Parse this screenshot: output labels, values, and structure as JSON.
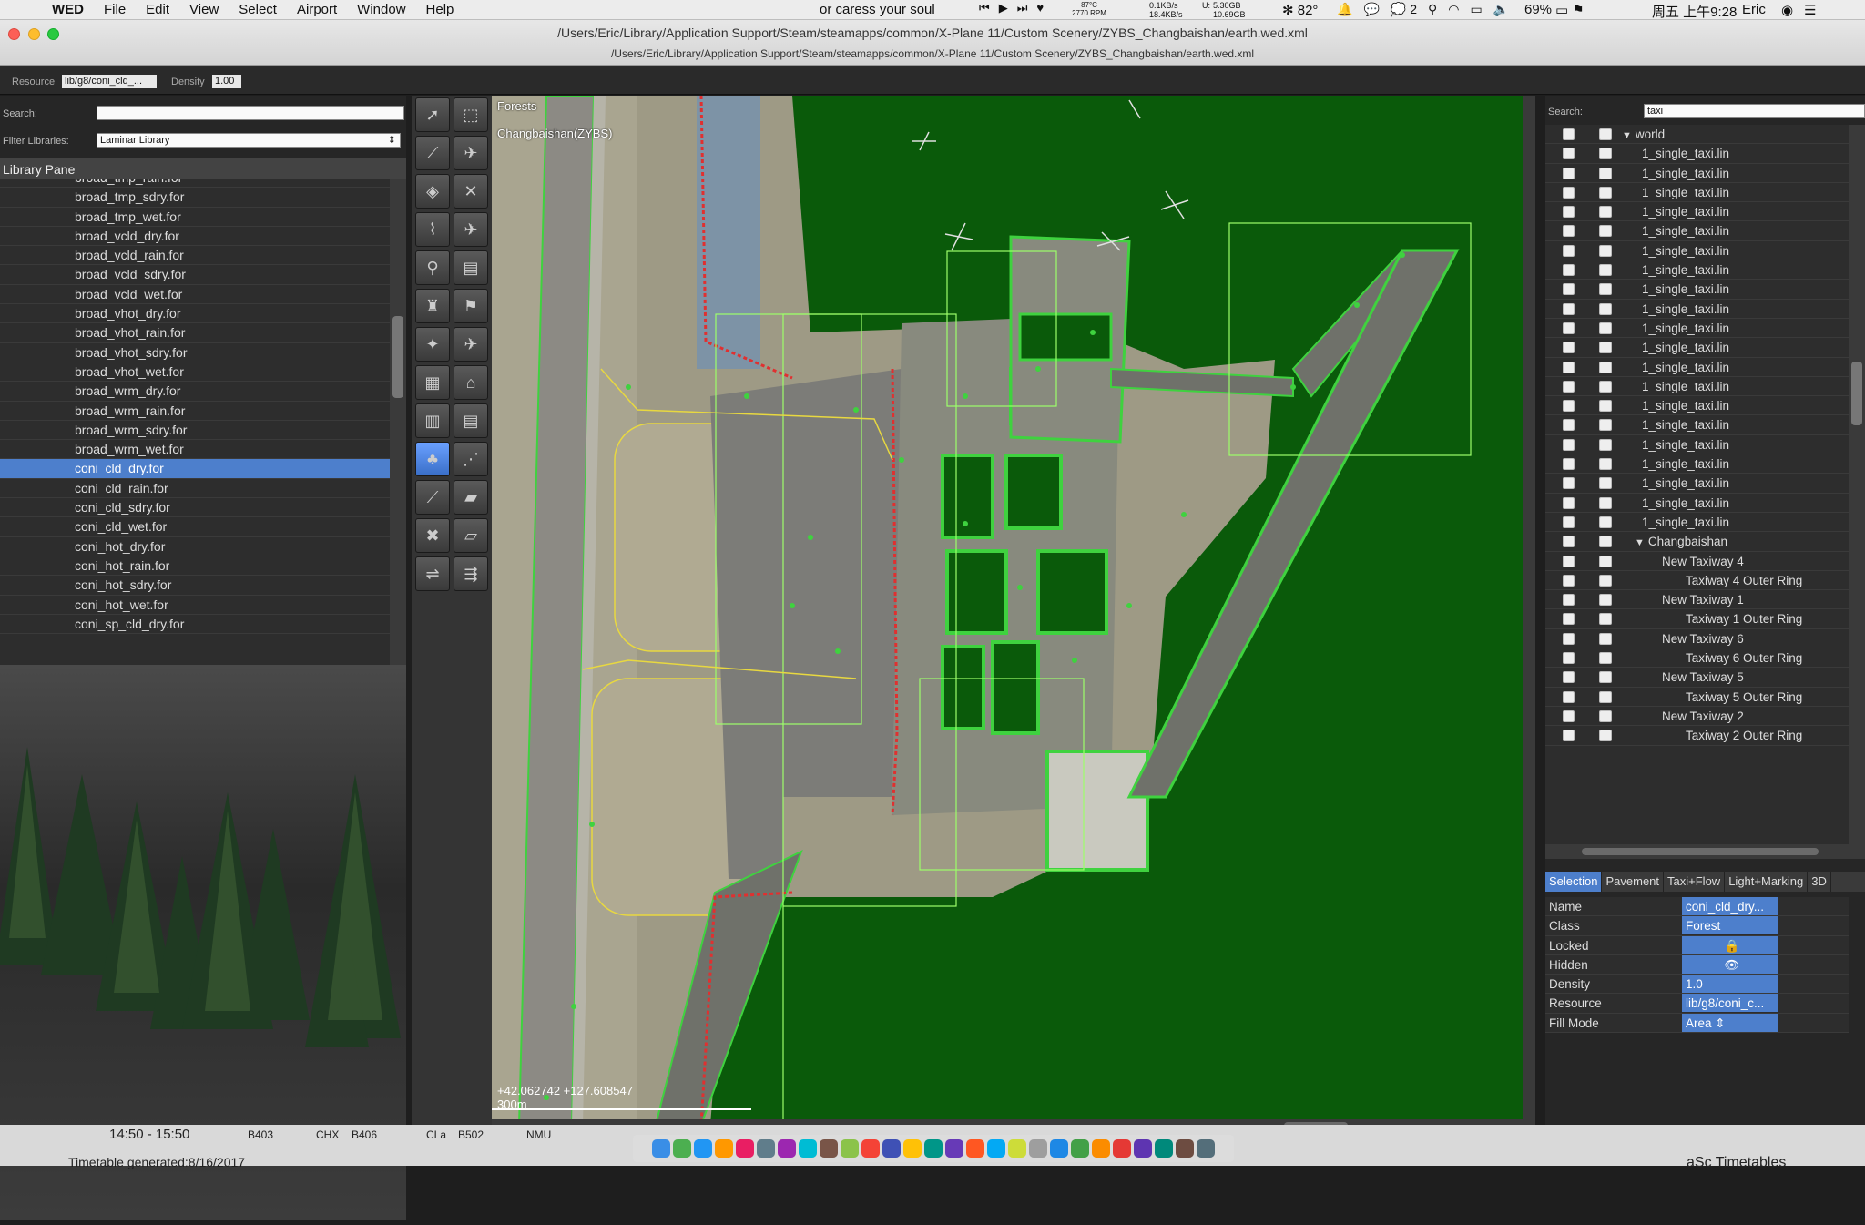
{
  "menubar": {
    "app": "WED",
    "menus": [
      "File",
      "Edit",
      "View",
      "Select",
      "Airport",
      "Window",
      "Help"
    ],
    "now_playing": "or caress your soul",
    "cpu_temp": "87°C",
    "fan": "2770 RPM",
    "net_up": "0.1KB/s",
    "net_down": "18.4KB/s",
    "disk_label": "U:",
    "disk1": "5.30GB",
    "disk2": "10.69GB",
    "temp": "82°",
    "wechat_count": "2",
    "battery": "69%",
    "clock": "周五 上午9:28",
    "user": "Eric"
  },
  "window": {
    "title": "/Users/Eric/Library/Application Support/Steam/steamapps/common/X-Plane 11/Custom Scenery/ZYBS_Changbaishan/earth.wed.xml",
    "subtitle": "/Users/Eric/Library/Application Support/Steam/steamapps/common/X-Plane 11/Custom Scenery/ZYBS_Changbaishan/earth.wed.xml"
  },
  "propbar": {
    "resource_label": "Resource",
    "resource_value": "lib/g8/coni_cld_...",
    "density_label": "Density",
    "density_value": "1.00"
  },
  "library": {
    "search_label": "Search:",
    "search_value": "",
    "filter_label": "Filter Libraries:",
    "filter_value": "Laminar Library",
    "pane_title": "Library Pane",
    "items": [
      "broad_tmp_rain.for",
      "broad_tmp_sdry.for",
      "broad_tmp_wet.for",
      "broad_vcld_dry.for",
      "broad_vcld_rain.for",
      "broad_vcld_sdry.for",
      "broad_vcld_wet.for",
      "broad_vhot_dry.for",
      "broad_vhot_rain.for",
      "broad_vhot_sdry.for",
      "broad_vhot_wet.for",
      "broad_wrm_dry.for",
      "broad_wrm_rain.for",
      "broad_wrm_sdry.for",
      "broad_wrm_wet.for",
      "coni_cld_dry.for",
      "coni_cld_rain.for",
      "coni_cld_sdry.for",
      "coni_cld_wet.for",
      "coni_hot_dry.for",
      "coni_hot_rain.for",
      "coni_hot_sdry.for",
      "coni_hot_wet.for",
      "coni_sp_cld_dry.for"
    ],
    "selected_index": 15
  },
  "map": {
    "layer_label": "Forests",
    "airport_label": "Changbaishan(ZYBS)",
    "coords": "+42.062742 +127.608547",
    "scale": "300m"
  },
  "hierarchy": {
    "search_label": "Search:",
    "search_value": "taxi",
    "rows": [
      {
        "indent": 1,
        "text": "world",
        "tri": "▼"
      },
      {
        "indent": 2,
        "text": "1_single_taxi.lin"
      },
      {
        "indent": 2,
        "text": "1_single_taxi.lin"
      },
      {
        "indent": 2,
        "text": "1_single_taxi.lin"
      },
      {
        "indent": 2,
        "text": "1_single_taxi.lin"
      },
      {
        "indent": 2,
        "text": "1_single_taxi.lin"
      },
      {
        "indent": 2,
        "text": "1_single_taxi.lin"
      },
      {
        "indent": 2,
        "text": "1_single_taxi.lin"
      },
      {
        "indent": 2,
        "text": "1_single_taxi.lin"
      },
      {
        "indent": 2,
        "text": "1_single_taxi.lin"
      },
      {
        "indent": 2,
        "text": "1_single_taxi.lin"
      },
      {
        "indent": 2,
        "text": "1_single_taxi.lin"
      },
      {
        "indent": 2,
        "text": "1_single_taxi.lin"
      },
      {
        "indent": 2,
        "text": "1_single_taxi.lin"
      },
      {
        "indent": 2,
        "text": "1_single_taxi.lin"
      },
      {
        "indent": 2,
        "text": "1_single_taxi.lin"
      },
      {
        "indent": 2,
        "text": "1_single_taxi.lin"
      },
      {
        "indent": 2,
        "text": "1_single_taxi.lin"
      },
      {
        "indent": 2,
        "text": "1_single_taxi.lin"
      },
      {
        "indent": 2,
        "text": "1_single_taxi.lin"
      },
      {
        "indent": 2,
        "text": "1_single_taxi.lin"
      },
      {
        "indent": 2,
        "text": "Changbaishan",
        "tri": "▼"
      },
      {
        "indent": 3,
        "text": "New Taxiway 4"
      },
      {
        "indent": 4,
        "text": "Taxiway 4 Outer Ring"
      },
      {
        "indent": 3,
        "text": "New Taxiway 1"
      },
      {
        "indent": 4,
        "text": "Taxiway 1 Outer Ring"
      },
      {
        "indent": 3,
        "text": "New Taxiway 6"
      },
      {
        "indent": 4,
        "text": "Taxiway 6 Outer Ring"
      },
      {
        "indent": 3,
        "text": "New Taxiway 5"
      },
      {
        "indent": 4,
        "text": "Taxiway 5 Outer Ring"
      },
      {
        "indent": 3,
        "text": "New Taxiway 2"
      },
      {
        "indent": 4,
        "text": "Taxiway 2 Outer Ring"
      }
    ]
  },
  "inspector": {
    "tabs": [
      "Selection",
      "Pavement",
      "Taxi+Flow",
      "Light+Marking",
      "3D"
    ],
    "active_tab": 0,
    "props": [
      {
        "key": "Name",
        "value": "coni_cld_dry..."
      },
      {
        "key": "Class",
        "value": "Forest"
      },
      {
        "key": "Locked",
        "value": "🔒"
      },
      {
        "key": "Hidden",
        "value": "👁"
      },
      {
        "key": "Density",
        "value": "1.0"
      },
      {
        "key": "Resource",
        "value": "lib/g8/coni_c..."
      },
      {
        "key": "Fill Mode",
        "value": "Area ⇕"
      }
    ]
  },
  "background": {
    "timetable_time": "14:50 - 15:50",
    "codes": [
      "B403",
      "CHX",
      "B406",
      "CLa",
      "B502",
      "NMU"
    ],
    "timetable_generated": "Timetable generated:8/16/2017",
    "timetables_title": "aSc Timetables"
  },
  "colors": {
    "selection": "#4d7fcc",
    "forest": "#0a5a0a",
    "boundary": "#3fd23f"
  }
}
